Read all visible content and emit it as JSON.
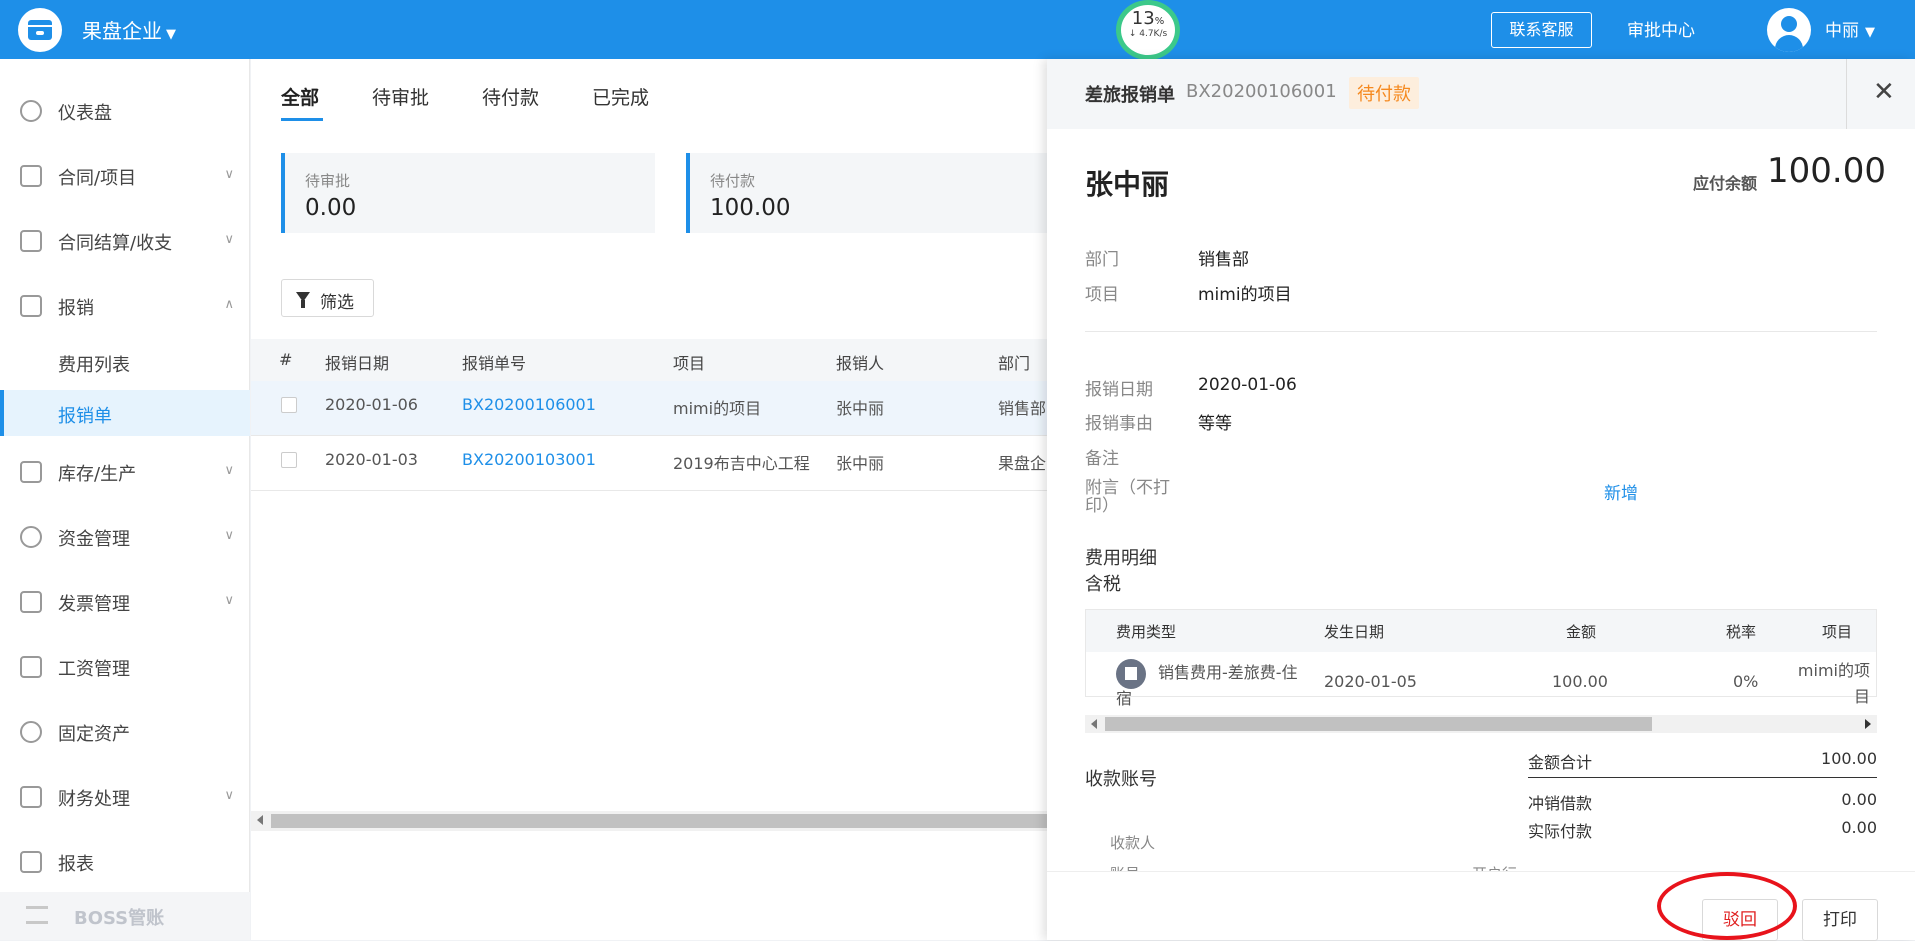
{
  "header": {
    "company": "果盘企业",
    "network": {
      "percent": "13",
      "unit": "%",
      "rate": "↓ 4.7K/s"
    },
    "service_btn": "联系客服",
    "approval_center": "审批中心",
    "user": "中丽"
  },
  "sidebar": {
    "items": [
      {
        "label": "仪表盘",
        "icon": "dashboard-icon"
      },
      {
        "label": "合同/项目",
        "icon": "folder-icon"
      },
      {
        "label": "合同结算/收支",
        "icon": "settlement-icon"
      },
      {
        "label": "报销",
        "icon": "reimburse-icon"
      },
      {
        "label": "库存/生产",
        "icon": "box-icon"
      },
      {
        "label": "资金管理",
        "icon": "coins-icon"
      },
      {
        "label": "发票管理",
        "icon": "invoice-icon"
      },
      {
        "label": "工资管理",
        "icon": "salary-icon"
      },
      {
        "label": "固定资产",
        "icon": "asset-icon"
      },
      {
        "label": "财务处理",
        "icon": "finance-icon"
      },
      {
        "label": "报表",
        "icon": "chart-bar-icon"
      }
    ],
    "sub_items": [
      "费用列表",
      "报销单"
    ],
    "boss": "BOSS管账"
  },
  "main": {
    "tabs": [
      "全部",
      "待审批",
      "待付款",
      "已完成"
    ],
    "stats": [
      {
        "title": "待审批",
        "value": "0.00"
      },
      {
        "title": "待付款",
        "value": "100.00"
      }
    ],
    "filter_label": "筛选",
    "columns": [
      "#",
      "报销日期",
      "报销单号",
      "项目",
      "报销人",
      "部门"
    ],
    "rows": [
      {
        "date": "2020-01-06",
        "no": "BX20200106001",
        "project": "mimi的项目",
        "person": "张中丽",
        "dept": "销售部"
      },
      {
        "date": "2020-01-03",
        "no": "BX20200103001",
        "project": "2019布吉中心工程",
        "person": "张中丽",
        "dept": "果盘企"
      }
    ]
  },
  "drawer": {
    "title": "差旅报销单",
    "number": "BX20200106001",
    "status": "待付款",
    "applicant": "张中丽",
    "payable_label": "应付余额",
    "payable_value": "100.00",
    "info": [
      {
        "label": "部门",
        "value": "销售部"
      },
      {
        "label": "项目",
        "value": "mimi的项目"
      }
    ],
    "details": [
      {
        "label": "报销日期",
        "value": "2020-01-06"
      },
      {
        "label": "报销事由",
        "value": "等等"
      },
      {
        "label": "备注",
        "value": ""
      },
      {
        "label": "附言（不打印）",
        "value": ""
      }
    ],
    "add_link": "新增",
    "expense_title": "费用明细",
    "tax_note": "含税",
    "expense_columns": [
      "费用类型",
      "发生日期",
      "金额",
      "税率",
      "项目"
    ],
    "expense_row": {
      "type": "销售费用-差旅费-住宿",
      "date": "2020-01-05",
      "amount": "100.00",
      "tax": "0%",
      "project": "mimi的项目"
    },
    "account_title": "收款账号",
    "summary": [
      {
        "label": "金额合计",
        "value": "100.00"
      },
      {
        "label": "冲销借款",
        "value": "0.00"
      },
      {
        "label": "实际付款",
        "value": "0.00"
      }
    ],
    "payee_label": "收款人",
    "account_label_cut": "账号",
    "bank_label_cut": "开户行",
    "reject_btn": "驳回",
    "print_btn": "打印"
  }
}
